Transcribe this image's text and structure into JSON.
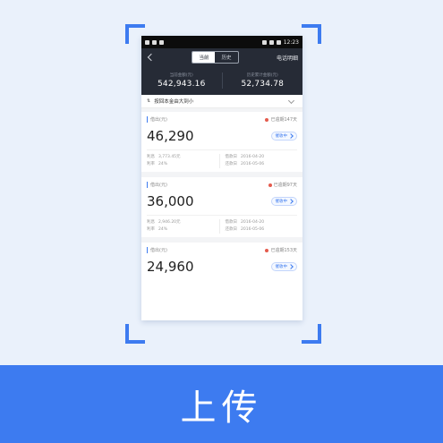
{
  "colors": {
    "accent": "#3d7bf0",
    "background": "#eaf1fb",
    "header": "#262b36",
    "overdue_dot": "#e45b4d"
  },
  "phone": {
    "statusbar": {
      "time": "12:23"
    },
    "nav": {
      "back_icon": "chevron-left-icon",
      "tabs": [
        {
          "label": "当前"
        },
        {
          "label": "历史"
        }
      ],
      "right_label": "电话明细"
    },
    "summary": [
      {
        "label": "当前金额(元)",
        "value": "542,943.16"
      },
      {
        "label": "历史累计金额(元)",
        "value": "52,734.78"
      }
    ],
    "sort": {
      "label": "按回本金由大到小"
    },
    "cards": [
      {
        "label": "借出(元)",
        "overdue": "已逾期147天",
        "amount": "46,290",
        "status": "催收中",
        "meta_left": [
          [
            "利息",
            "3,773.45元"
          ],
          [
            "利率",
            "24%"
          ]
        ],
        "meta_right": [
          [
            "借款日",
            "2016-04-20"
          ],
          [
            "还款日",
            "2016-05-06"
          ]
        ]
      },
      {
        "label": "借出(元)",
        "overdue": "已逾期97天",
        "amount": "36,000",
        "status": "催收中",
        "meta_left": [
          [
            "利息",
            "2,946.20元"
          ],
          [
            "利率",
            "24%"
          ]
        ],
        "meta_right": [
          [
            "借款日",
            "2016-04-20"
          ],
          [
            "还款日",
            "2016-05-06"
          ]
        ]
      },
      {
        "label": "借出(元)",
        "overdue": "已逾期153天",
        "amount": "24,960",
        "status": "催收中"
      }
    ]
  },
  "upload": {
    "label": "上传"
  }
}
